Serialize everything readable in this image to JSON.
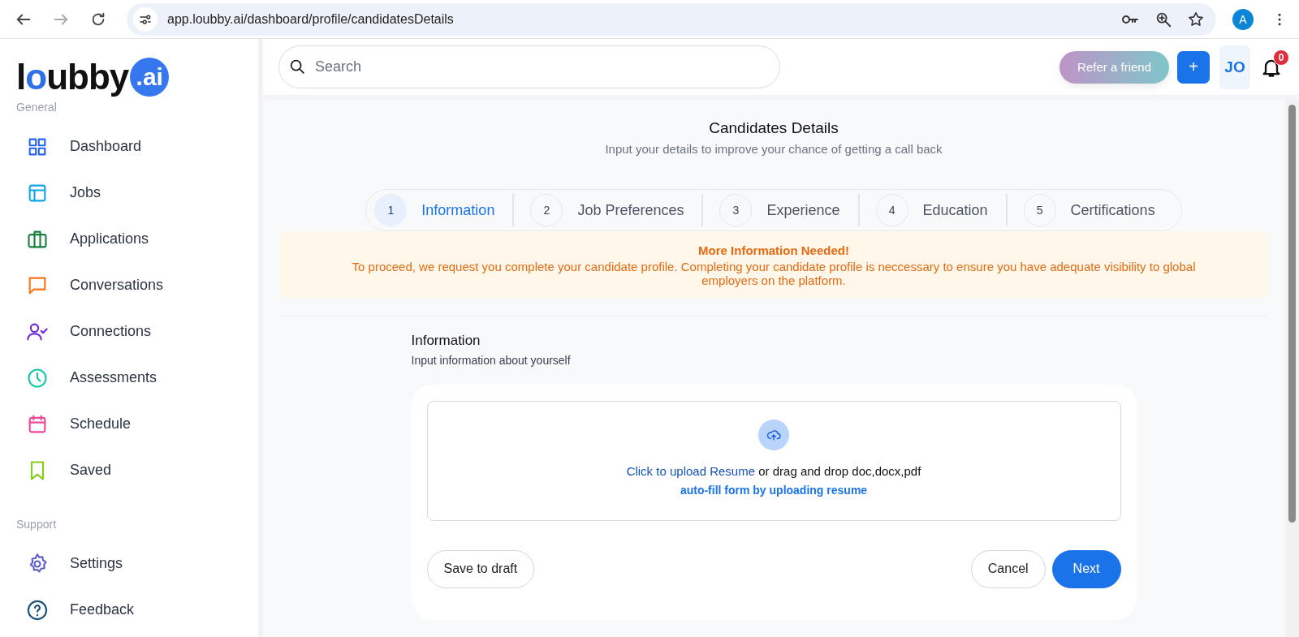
{
  "browser": {
    "url": "app.loubby.ai/dashboard/profile/candidatesDetails",
    "profile_initial": "A"
  },
  "logo": {
    "word": "loubby",
    "badge": ".ai"
  },
  "sidebar": {
    "sections": [
      {
        "title": "General",
        "items": [
          {
            "label": "Dashboard"
          },
          {
            "label": "Jobs"
          },
          {
            "label": "Applications"
          },
          {
            "label": "Conversations"
          },
          {
            "label": "Connections"
          },
          {
            "label": "Assessments"
          },
          {
            "label": "Schedule"
          },
          {
            "label": "Saved"
          }
        ]
      },
      {
        "title": "Support",
        "items": [
          {
            "label": "Settings"
          },
          {
            "label": "Feedback"
          }
        ]
      }
    ]
  },
  "topbar": {
    "search": {
      "placeholder": "Search"
    },
    "refer_button": "Refer a friend",
    "add_button": "+",
    "avatar": "JO",
    "notifications": "0"
  },
  "page": {
    "title": "Candidates Details",
    "subtitle": "Input your details to improve your chance of getting a call back",
    "steps": [
      {
        "number": "1",
        "label": "Information",
        "selected": true
      },
      {
        "number": "2",
        "label": "Job Preferences",
        "selected": false
      },
      {
        "number": "3",
        "label": "Experience",
        "selected": false
      },
      {
        "number": "4",
        "label": "Education",
        "selected": false
      },
      {
        "number": "5",
        "label": "Certifications",
        "selected": false
      }
    ],
    "alert": {
      "title": "More Information Needed!",
      "message": "To proceed, we request you complete your candidate profile. Completing your candidate profile is neccessary to ensure you have adequate visibility to global employers on the platform."
    },
    "section": {
      "title": "Information",
      "subtitle": "Input information about yourself"
    },
    "upload": {
      "link": "Click to upload Resume",
      "text": "or drag and drop doc,docx,pdf",
      "hint": "auto-fill form by uploading resume"
    },
    "buttons": {
      "save_draft": "Save to draft",
      "cancel": "Cancel",
      "next": "Next"
    }
  }
}
